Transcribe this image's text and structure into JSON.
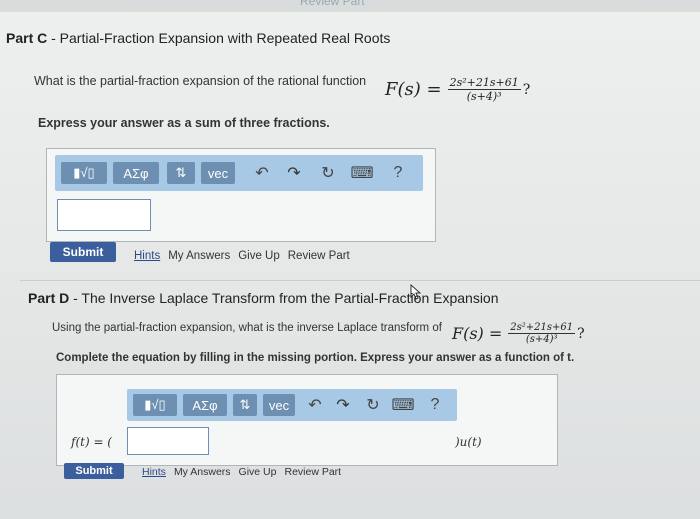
{
  "top_fragment": "Review Part",
  "partC": {
    "label": "Part C",
    "title": " - Partial-Fraction Expansion with Repeated Real Roots",
    "question": "What is the partial-fraction expansion of the rational function",
    "func_lhs": "F(s) =",
    "numerator": "2s²+21s+61",
    "denominator": "(s+4)³",
    "qmark": "?",
    "instruction": "Express your answer as a sum of three fractions.",
    "toolbar": {
      "templates": "▮√▯",
      "greek": "ΑΣφ",
      "arrows": "⇅",
      "vec": "vec",
      "undo": "↶",
      "redo": "↷",
      "reset": "↻",
      "keyboard": "⌨",
      "help": "?"
    },
    "submit": "Submit",
    "links": {
      "hints": "Hints",
      "my_answers": "My Answers",
      "give_up": "Give Up",
      "review": "Review Part"
    }
  },
  "partD": {
    "label": "Part D",
    "title": " - The Inverse Laplace Transform from the Partial-Fraction Expansion",
    "question": "Using the partial-fraction expansion, what is the inverse Laplace transform of",
    "func_lhs": "F(s) =",
    "numerator": "2s²+21s+61",
    "denominator": "(s+4)³",
    "qmark": "?",
    "instruction": "Complete the equation by filling in the missing portion. Express your answer as a function of t.",
    "toolbar": {
      "templates": "▮√▯",
      "greek": "ΑΣφ",
      "arrows": "⇅",
      "vec": "vec",
      "undo": "↶",
      "redo": "↷",
      "reset": "↻",
      "keyboard": "⌨",
      "help": "?"
    },
    "eq_prefix": "f(t) = (",
    "eq_suffix": ")u(t)",
    "submit": "Submit",
    "links": {
      "hints": "Hints",
      "my_answers": "My Answers",
      "give_up": "Give Up",
      "review": "Review Part"
    }
  }
}
